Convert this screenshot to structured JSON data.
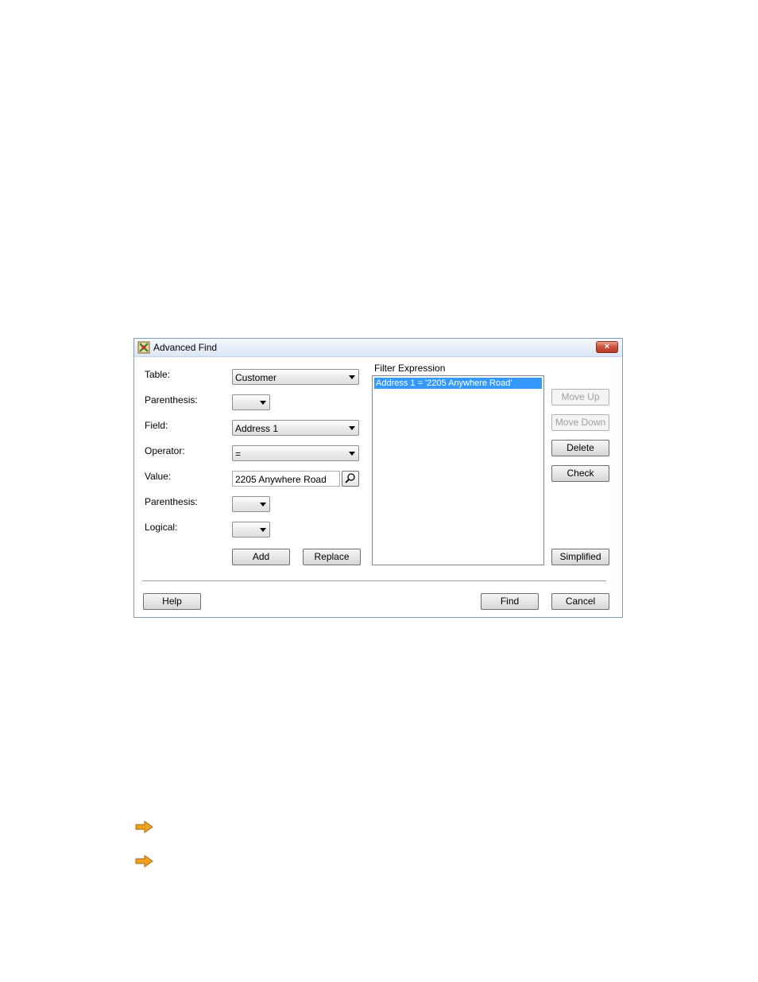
{
  "dialog": {
    "title": "Advanced Find",
    "close_label": "×",
    "labels": {
      "table": "Table:",
      "parenthesis_open": "Parenthesis:",
      "field": "Field:",
      "operator": "Operator:",
      "value": "Value:",
      "parenthesis_close": "Parenthesis:",
      "logical": "Logical:",
      "filter_expression": "Filter Expression"
    },
    "inputs": {
      "table": "Customer",
      "parenthesis_open": "",
      "field": "Address 1",
      "operator": "=",
      "value": "2205 Anywhere Road",
      "parenthesis_close": "",
      "logical": ""
    },
    "filter_items": [
      "Address 1 = '2205 Anywhere Road'"
    ],
    "buttons": {
      "add": "Add",
      "replace": "Replace",
      "move_up": "Move Up",
      "move_down": "Move Down",
      "delete": "Delete",
      "check": "Check",
      "simplified": "Simplified",
      "help": "Help",
      "find": "Find",
      "cancel": "Cancel"
    }
  },
  "icons": {
    "app": "advanced-find-icon",
    "lookup": "magnifier-icon",
    "bullet": "arrow-right-icon"
  },
  "colors": {
    "selection": "#3399ff",
    "close_button": "#c9503a",
    "bullet": "#f0a020"
  }
}
